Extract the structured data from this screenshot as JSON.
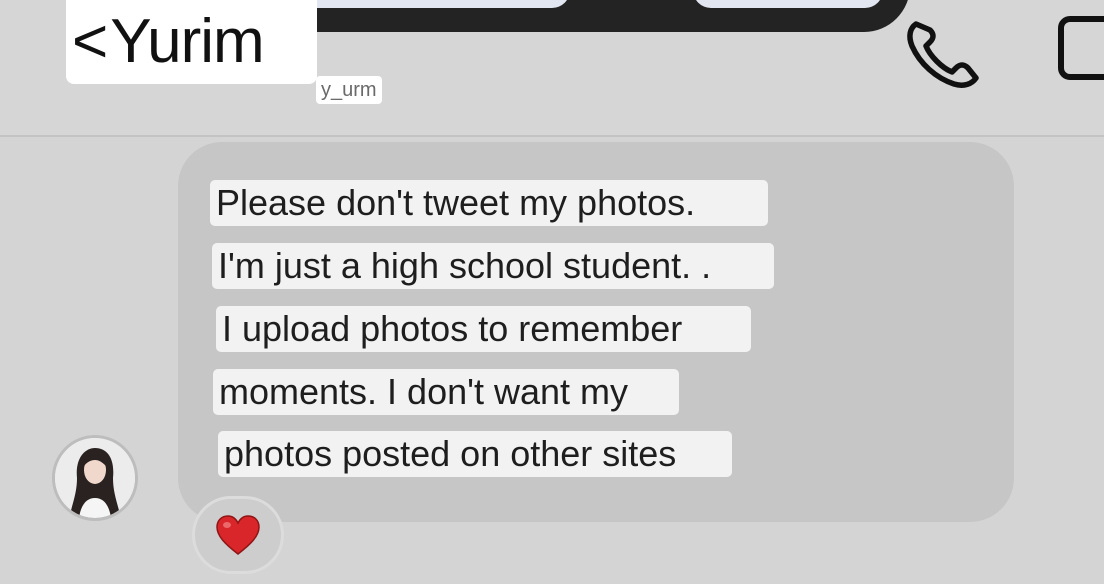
{
  "header": {
    "back_chevron": "<",
    "contact_name": "Yurim",
    "username": "y_urm",
    "icons": [
      "phone-icon",
      "video-call-icon"
    ]
  },
  "conversation": {
    "message_lines": [
      "Please don't tweet my photos.",
      "I'm just a high school student. .",
      "I upload photos to remember",
      "moments. I don't want my",
      "photos posted on other sites"
    ],
    "reaction": "heart-icon"
  },
  "colors": {
    "background": "#d4d4d4",
    "bubble": "#c6c6c6",
    "text_highlight": "#f2f2f2",
    "notch": "#232323",
    "heart": "#d8262a"
  }
}
